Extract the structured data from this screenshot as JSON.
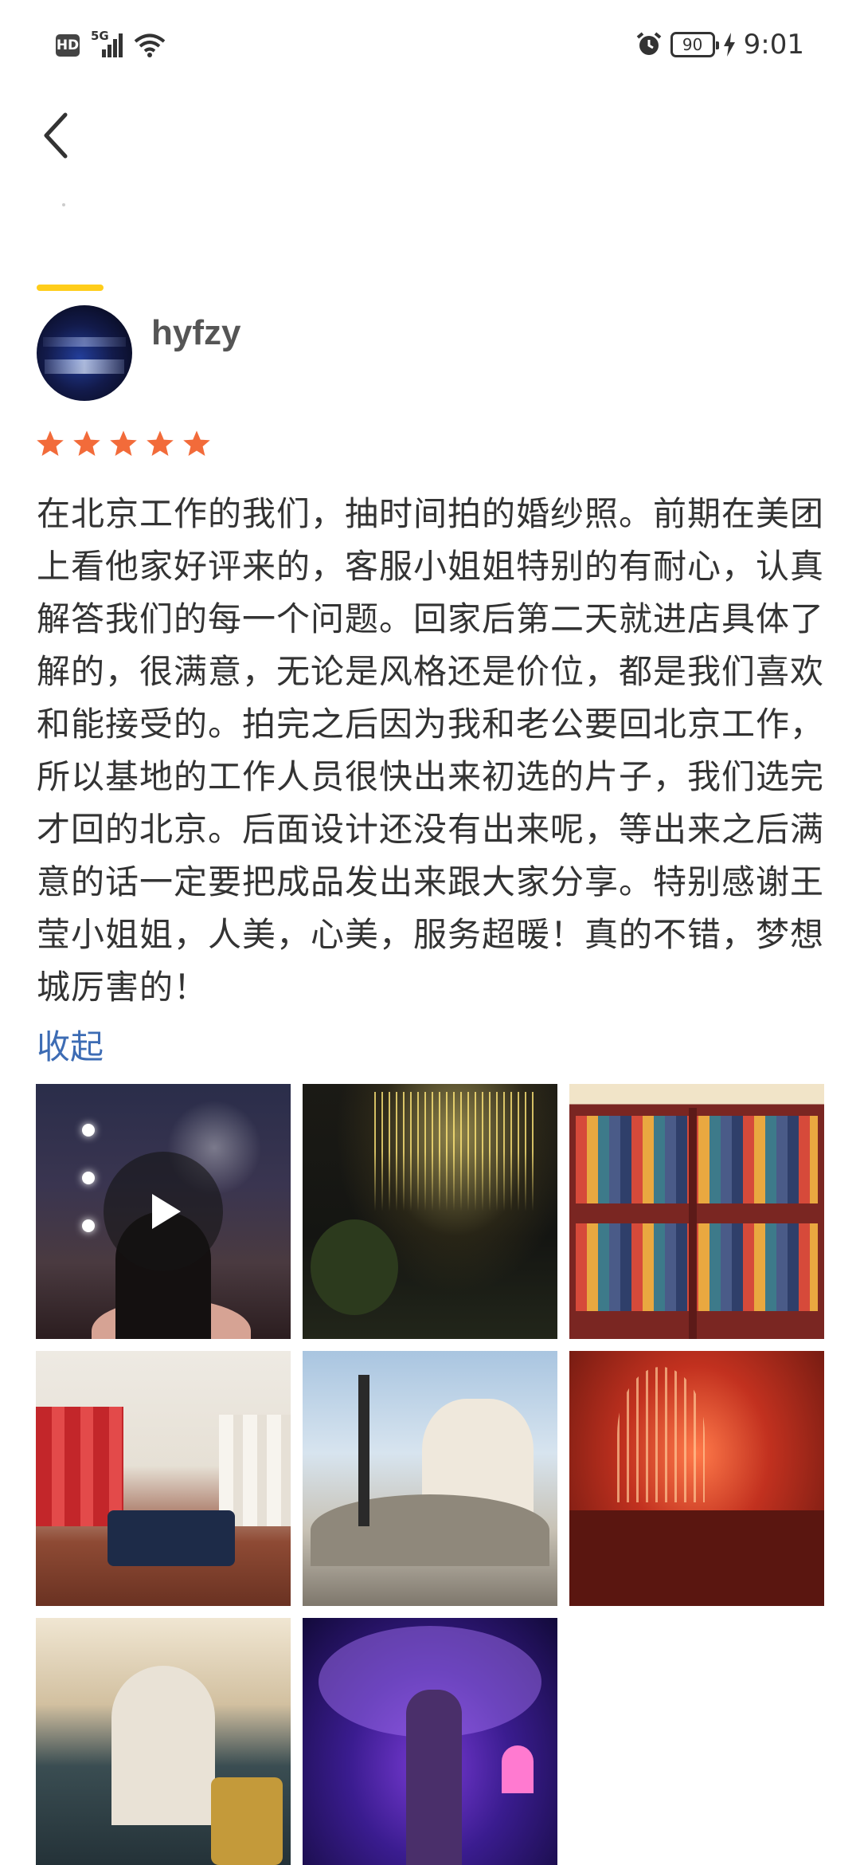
{
  "status_bar": {
    "left": {
      "hd": "HD",
      "network": "5G"
    },
    "battery": "90",
    "time": "9:01"
  },
  "review": {
    "username": "hyfzy",
    "rating": 5,
    "text": "在北京工作的我们，抽时间拍的婚纱照。前期在美团上看他家好评来的，客服小姐姐特别的有耐心，认真解答我们的每一个问题。回家后第二天就进店具体了解的，很满意，无论是风格还是价位，都是我们喜欢和能接受的。拍完之后因为我和老公要回北京工作，所以基地的工作人员很快出来初选的片子，我们选完才回的北京。后面设计还没有出来呢，等出来之后满意的话一定要把成品发出来跟大家分享。特别感谢王莹小姐姐，人美，心美，服务超暖！真的不错，梦想城厉害的！",
    "collapse_label": "收起"
  },
  "colors": {
    "accent_bar": "#ffcd1a",
    "star": "#f26b3a",
    "link": "#3d6cb4",
    "text": "#333333"
  },
  "icons": {
    "back": "chevron-left-icon",
    "play": "play-icon",
    "star": "star-icon"
  }
}
